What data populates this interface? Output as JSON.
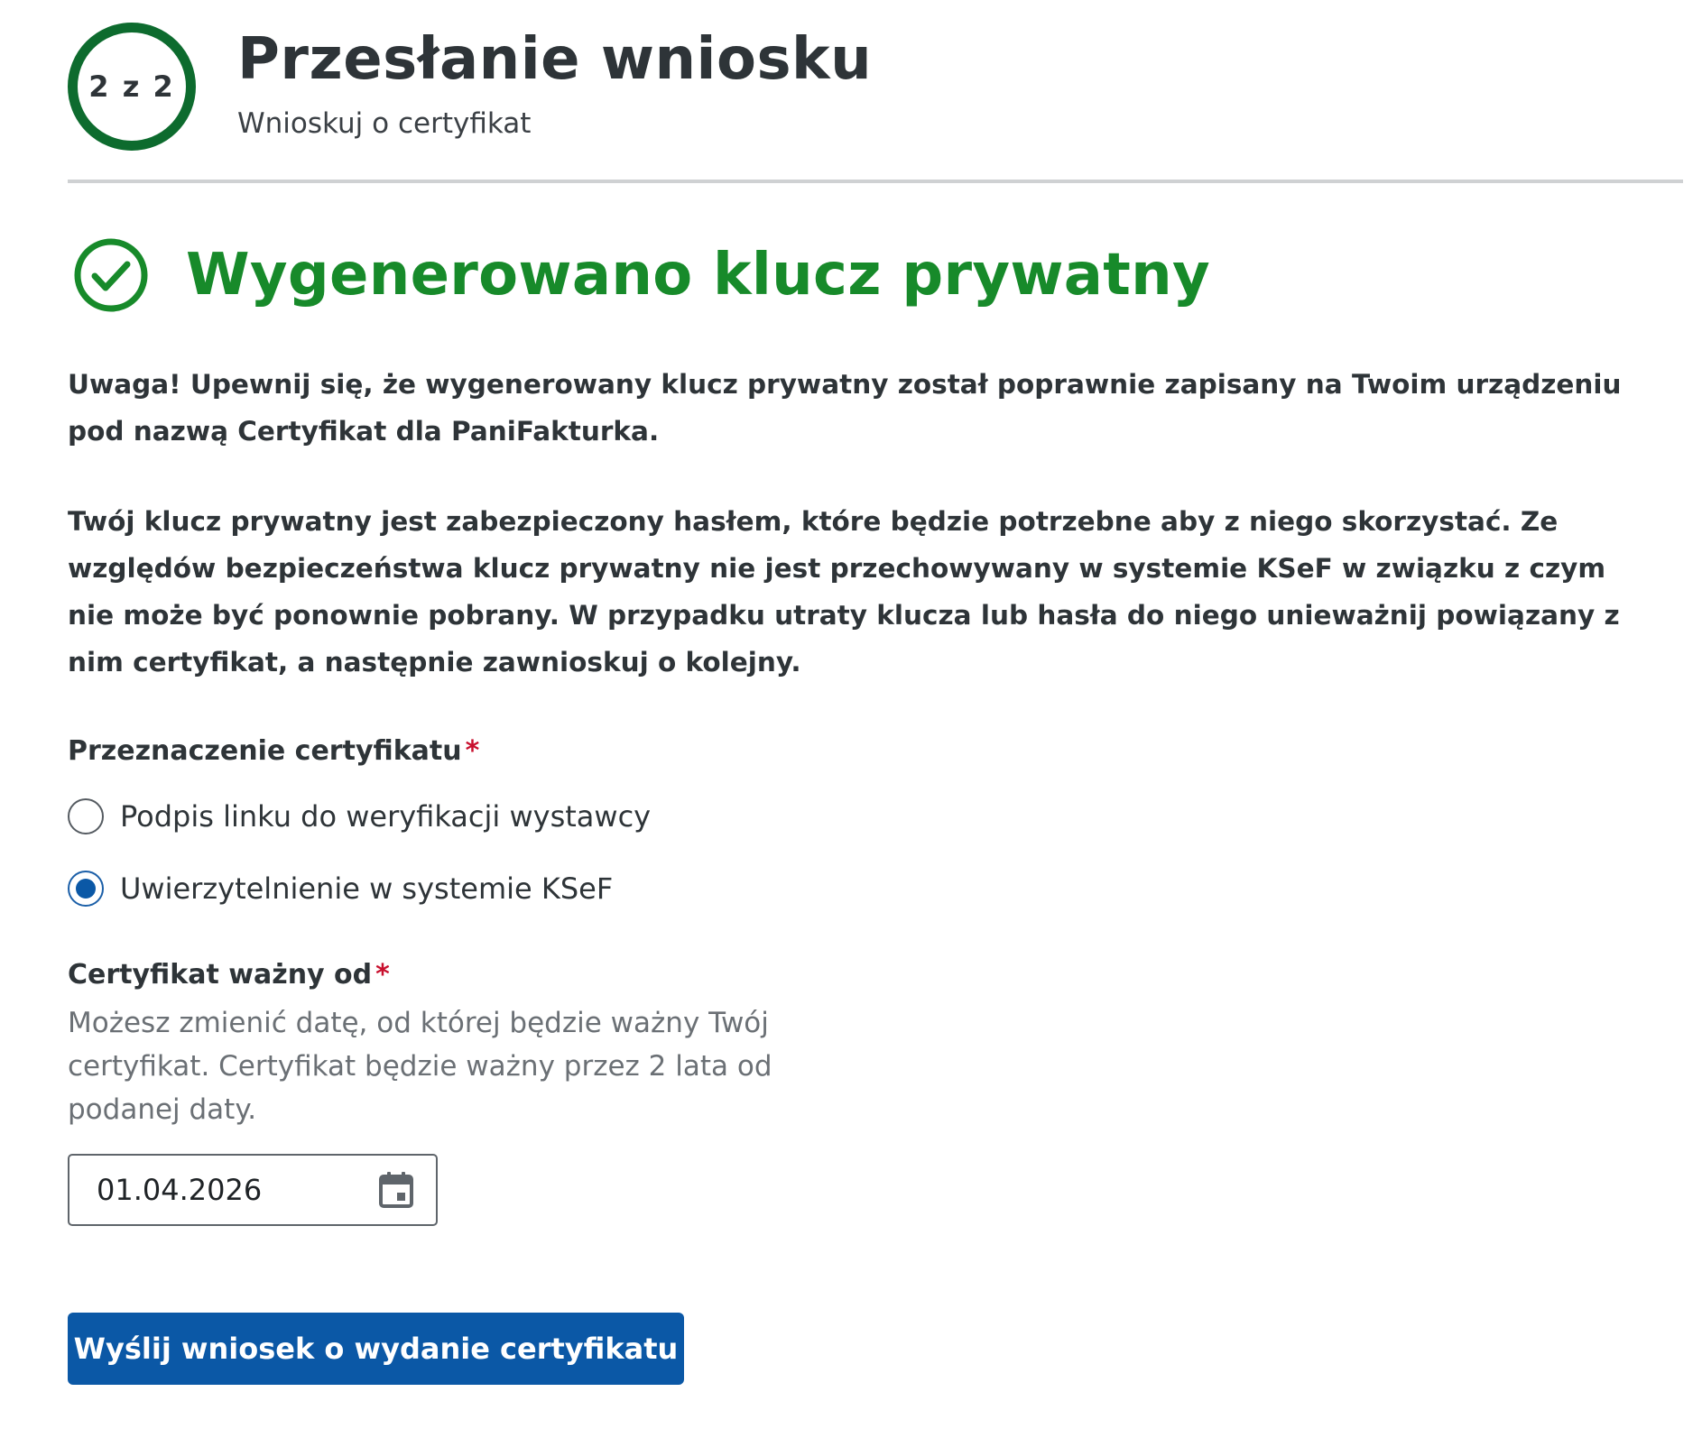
{
  "header": {
    "step_indicator": "2 z 2",
    "title": "Przesłanie wniosku",
    "subtitle": "Wnioskuj o certyfikat"
  },
  "success": {
    "icon": "check-circle-icon",
    "title": "Wygenerowano klucz prywatny",
    "color": "#178a2a"
  },
  "notice": {
    "paragraph_1": "Uwaga! Upewnij się, że wygenerowany klucz prywatny został poprawnie zapisany na Twoim urządzeniu pod nazwą Certyfikat dla PaniFakturka.",
    "paragraph_2": "Twój klucz prywatny jest zabezpieczony hasłem, które będzie potrzebne aby z niego skorzystać. Ze względów bezpieczeństwa klucz prywatny nie jest przechowywany w systemie KSeF w związku z czym nie może być ponownie pobrany. W przypadku utraty klucza lub hasła do niego unieważnij powiązany z nim certyfikat, a następnie zawnioskuj o kolejny."
  },
  "purpose": {
    "label": "Przeznaczenie certyfikatu",
    "required_mark": "*",
    "options": [
      {
        "label": "Podpis linku do weryfikacji wystawcy",
        "checked": false
      },
      {
        "label": "Uwierzytelnienie w systemie KSeF",
        "checked": true
      }
    ]
  },
  "valid_from": {
    "label": "Certyfikat ważny od",
    "required_mark": "*",
    "help": "Możesz zmienić datę, od której będzie ważny Twój certyfikat. Certyfikat będzie ważny przez 2 lata od podanej daty.",
    "value": "01.04.2026",
    "icon": "calendar-icon"
  },
  "submit": {
    "label": "Wyślij wniosek o wydanie certyfikatu",
    "color": "#0b58a6"
  },
  "colors": {
    "step_ring": "#0d6b2e",
    "required": "#c8102e",
    "text": "#2e3438",
    "help_text": "#6b7075"
  }
}
